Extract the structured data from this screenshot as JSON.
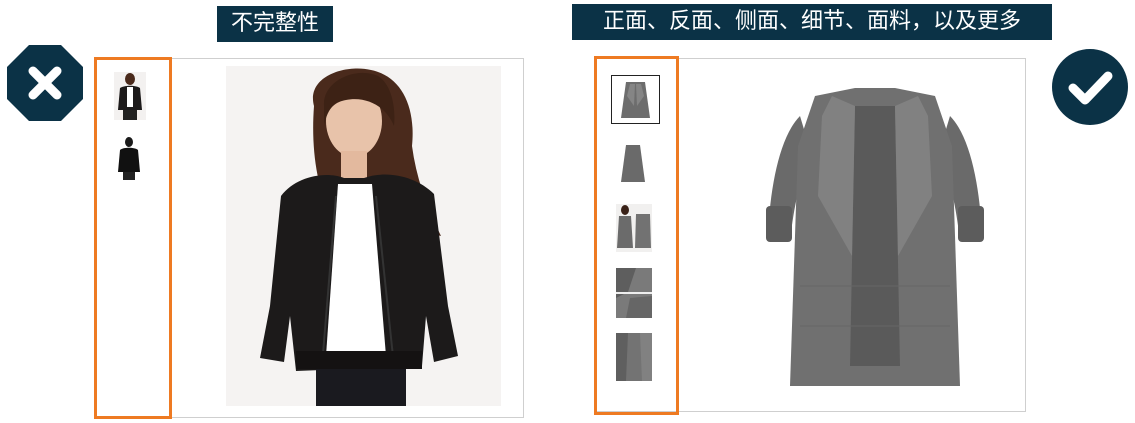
{
  "labels": {
    "left": "不完整性",
    "right": "正面、反面、侧面、细节、面料，以及更多"
  },
  "colors": {
    "label_bg": "#0b3246",
    "badge_bg": "#0b3246",
    "highlight": "#ee7a22",
    "panel_border": "#cfcfcf",
    "jacket": "#1c1a1a",
    "coat": "#6b6b6b"
  },
  "left_example": {
    "verdict_icon": "x-octagon-icon",
    "thumbnails": [
      "thumb-model-front",
      "thumb-jacket-back"
    ],
    "main_image": "model-wearing-black-bomber-jacket"
  },
  "right_example": {
    "verdict_icon": "checkmark-circle-icon",
    "thumbnails": [
      "thumb-coat-front",
      "thumb-coat-back",
      "thumb-coat-on-model",
      "thumb-coat-detail",
      "thumb-coat-fabric"
    ],
    "selected_thumbnail": 0,
    "main_image": "grey-open-front-coat"
  }
}
